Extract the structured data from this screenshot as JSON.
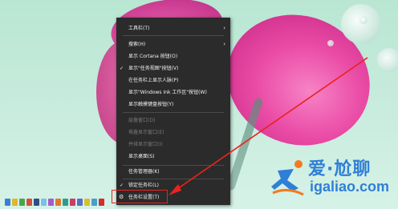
{
  "context_menu": {
    "items": [
      {
        "label": "工具栏(T)",
        "submenu": true,
        "enabled": true,
        "checked": false
      },
      {
        "label": "搜索(H)",
        "submenu": true,
        "enabled": true,
        "checked": false
      },
      {
        "label": "显示 Cortana 按钮(O)",
        "submenu": false,
        "enabled": true,
        "checked": false
      },
      {
        "label": "显示\"任务视图\"按钮(V)",
        "submenu": false,
        "enabled": true,
        "checked": true
      },
      {
        "label": "在任务栏上显示人脉(P)",
        "submenu": false,
        "enabled": true,
        "checked": false
      },
      {
        "label": "显示\"Windows Ink 工作区\"按钮(W)",
        "submenu": false,
        "enabled": true,
        "checked": false
      },
      {
        "label": "显示触摸键盘按钮(Y)",
        "submenu": false,
        "enabled": true,
        "checked": false
      },
      {
        "label": "层叠窗口(D)",
        "submenu": false,
        "enabled": false,
        "checked": false
      },
      {
        "label": "堆叠显示窗口(E)",
        "submenu": false,
        "enabled": false,
        "checked": false
      },
      {
        "label": "并排显示窗口(I)",
        "submenu": false,
        "enabled": false,
        "checked": false
      },
      {
        "label": "显示桌面(S)",
        "submenu": false,
        "enabled": true,
        "checked": false
      },
      {
        "label": "任务管理器(K)",
        "submenu": false,
        "enabled": true,
        "checked": false
      },
      {
        "label": "锁定任务栏(L)",
        "submenu": false,
        "enabled": true,
        "checked": true
      },
      {
        "label": "任务栏设置(T)",
        "submenu": false,
        "enabled": true,
        "checked": false,
        "icon": "gear-icon"
      }
    ]
  },
  "icons": {
    "submenu": "chevron-right-icon",
    "check": "check-icon",
    "settings": "gear-icon"
  },
  "colors": {
    "menu_background": "#2b2b2b",
    "annotation_red": "#e8231e",
    "watermark_blue": "#2f7fd6"
  },
  "watermark": {
    "text_cn": "爱·尬聊",
    "url": "igaliao.com"
  }
}
